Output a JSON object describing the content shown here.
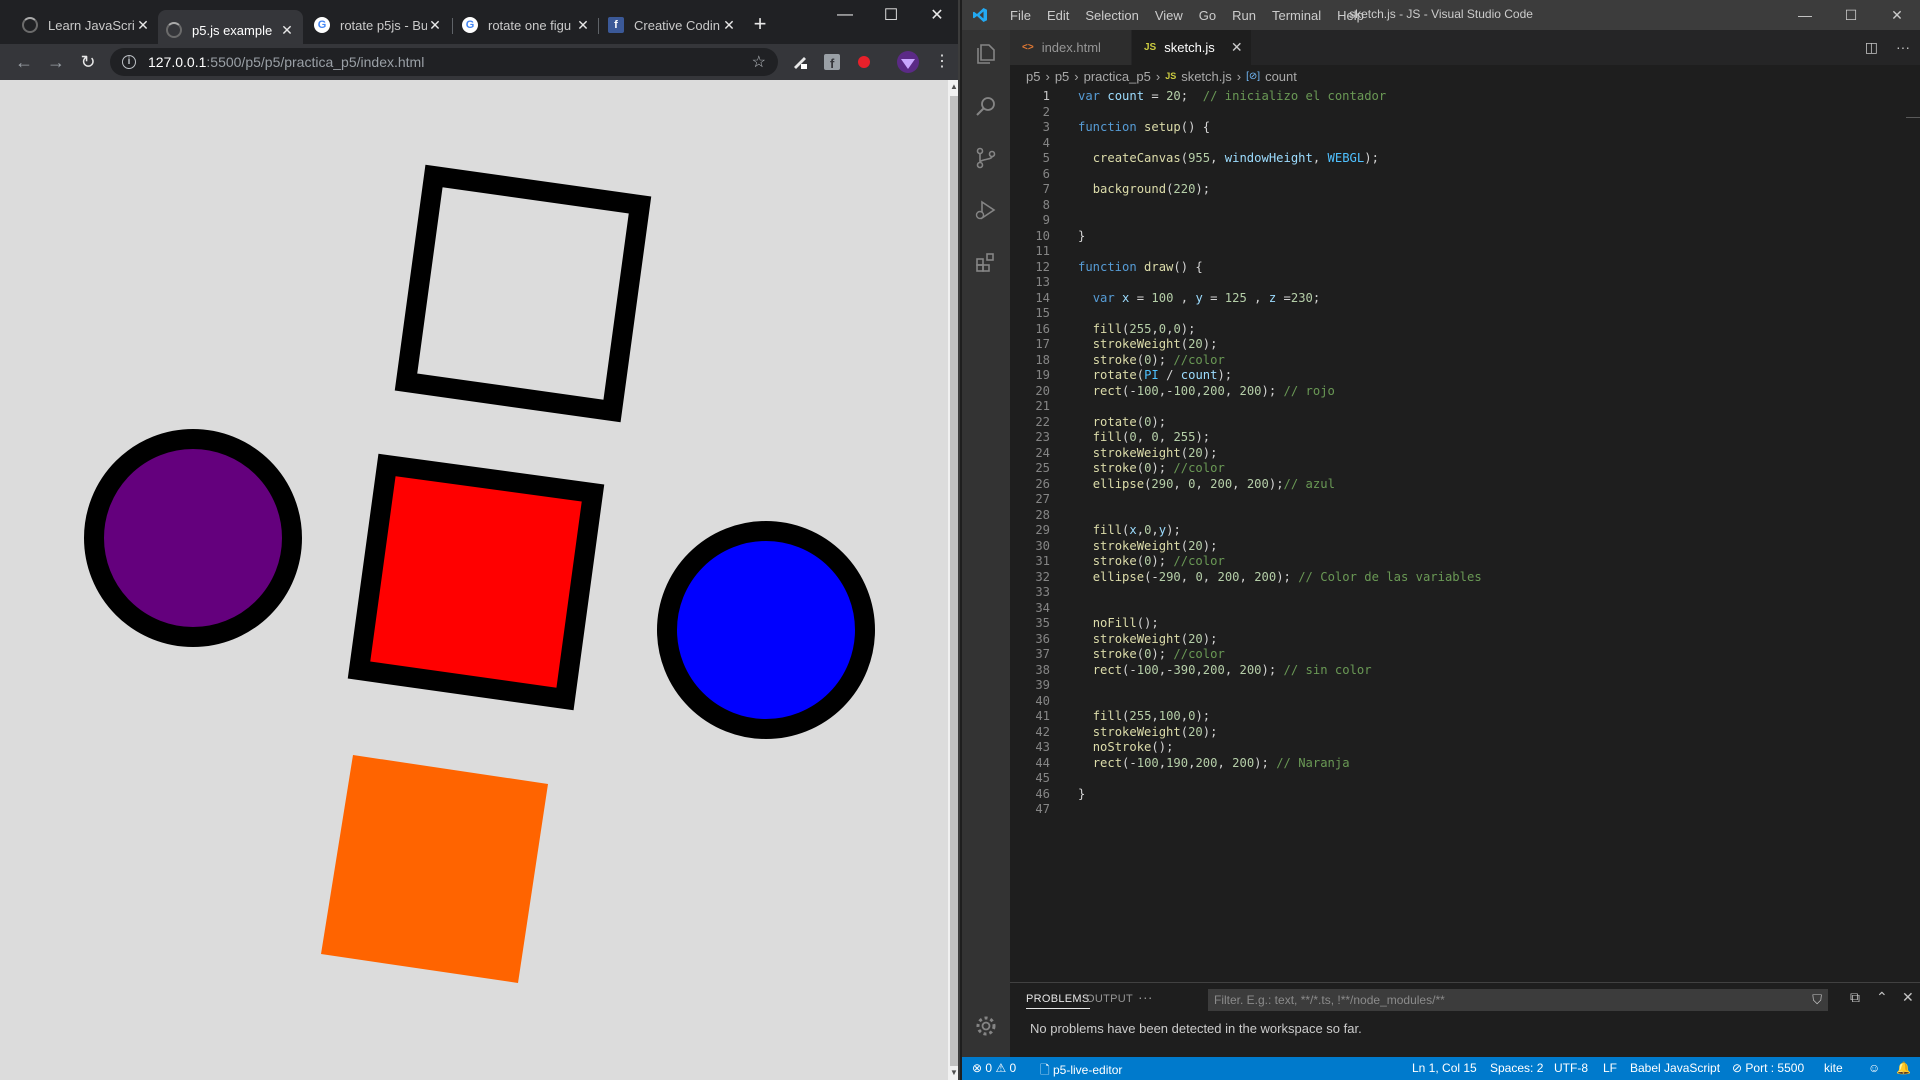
{
  "browser": {
    "tabs": [
      {
        "title": "Learn JavaScrip",
        "icon": "loading-spinner-icon"
      },
      {
        "title": "p5.js example",
        "icon": "loading-spinner-icon"
      },
      {
        "title": "rotate p5js - Bu",
        "icon": "google-icon"
      },
      {
        "title": "rotate one figu",
        "icon": "google-icon"
      },
      {
        "title": "Creative Codin",
        "icon": "facebook-icon"
      }
    ],
    "active_tab": 1,
    "url_host": "127.0.0.1",
    "url_path": ":5500/p5/p5/practica_p5/index.html",
    "canvas_background": "#dcdcdc"
  },
  "vscode": {
    "window_title": "sketch.js - JS - Visual Studio Code",
    "menu": [
      "File",
      "Edit",
      "Selection",
      "View",
      "Go",
      "Run",
      "Terminal",
      "Help"
    ],
    "tabs": [
      {
        "label": "index.html",
        "icon": "<>"
      },
      {
        "label": "sketch.js",
        "icon": "JS"
      }
    ],
    "breadcrumb": [
      "p5",
      "p5",
      "practica_p5",
      "sketch.js",
      "count"
    ],
    "code_lines": [
      "var count = 20;  // inicializo el contador",
      "",
      "function setup() {",
      "",
      "  createCanvas(955, windowHeight, WEBGL);",
      "",
      "  background(220);",
      "",
      "",
      "}",
      "",
      "function draw() {",
      "",
      "  var x = 100 , y = 125 , z =230;",
      "",
      "  fill(255,0,0);",
      "  strokeWeight(20);",
      "  stroke(0); //color",
      "  rotate(PI / count);",
      "  rect(-100,-100,200, 200); // rojo",
      "",
      "  rotate(0);",
      "  fill(0, 0, 255);",
      "  strokeWeight(20);",
      "  stroke(0); //color",
      "  ellipse(290, 0, 200, 200);// azul",
      "",
      "",
      "  fill(x,0,y);",
      "  strokeWeight(20);",
      "  stroke(0); //color",
      "  ellipse(-290, 0, 200, 200); // Color de las variables",
      "",
      "",
      "  noFill();",
      "  strokeWeight(20);",
      "  stroke(0); //color",
      "  rect(-100,-390,200, 200); // sin color",
      "",
      "",
      "  fill(255,100,0);",
      "  strokeWeight(20);",
      "  noStroke();",
      "  rect(-100,190,200, 200); // Naranja",
      "",
      "}",
      ""
    ],
    "panel": {
      "tabs": [
        "PROBLEMS",
        "OUTPUT"
      ],
      "more": "···",
      "filter_placeholder": "Filter. E.g.: text, **/*.ts, !**/node_modules/**",
      "message": "No problems have been detected in the workspace so far."
    },
    "status": {
      "errors": "0",
      "warnings": "0",
      "project": "p5-live-editor",
      "position": "Ln 1, Col 15",
      "spaces": "Spaces: 2",
      "encoding": "UTF-8",
      "eol": "LF",
      "language": "Babel JavaScript",
      "port": "Port : 5500",
      "kite": "kite"
    }
  }
}
